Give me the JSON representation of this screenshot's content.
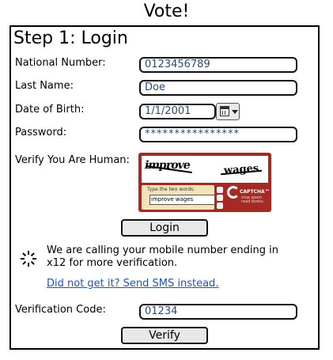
{
  "page": {
    "title": "Vote!",
    "step_title": "Step 1: Login"
  },
  "form": {
    "national_number_label": "National Number:",
    "national_number_value": "0123456789",
    "last_name_label": "Last Name:",
    "last_name_value": "Doe",
    "dob_label": "Date of Birth:",
    "dob_value": "1/1/2001",
    "password_label": "Password:",
    "password_value": "****************",
    "captcha_label": "Verify You Are Human:"
  },
  "captcha": {
    "word1": "improve",
    "word2": "wages",
    "hint": "Type the two words:",
    "input_value": "improve wages",
    "brand": "CAPTCHA™",
    "tagline": "stop spam. read books."
  },
  "login_button": "Login",
  "verification": {
    "message": "We are calling your mobile number ending in x12 for more verification.",
    "sms_link": "Did not get it? Send SMS instead.",
    "code_label": "Verification Code:",
    "code_value": "01234",
    "verify_button": "Verify"
  },
  "icons": {
    "calendar": "calendar-icon",
    "spinner": "loading-spinner-icon",
    "recaptcha": "recaptcha-logo-icon"
  }
}
